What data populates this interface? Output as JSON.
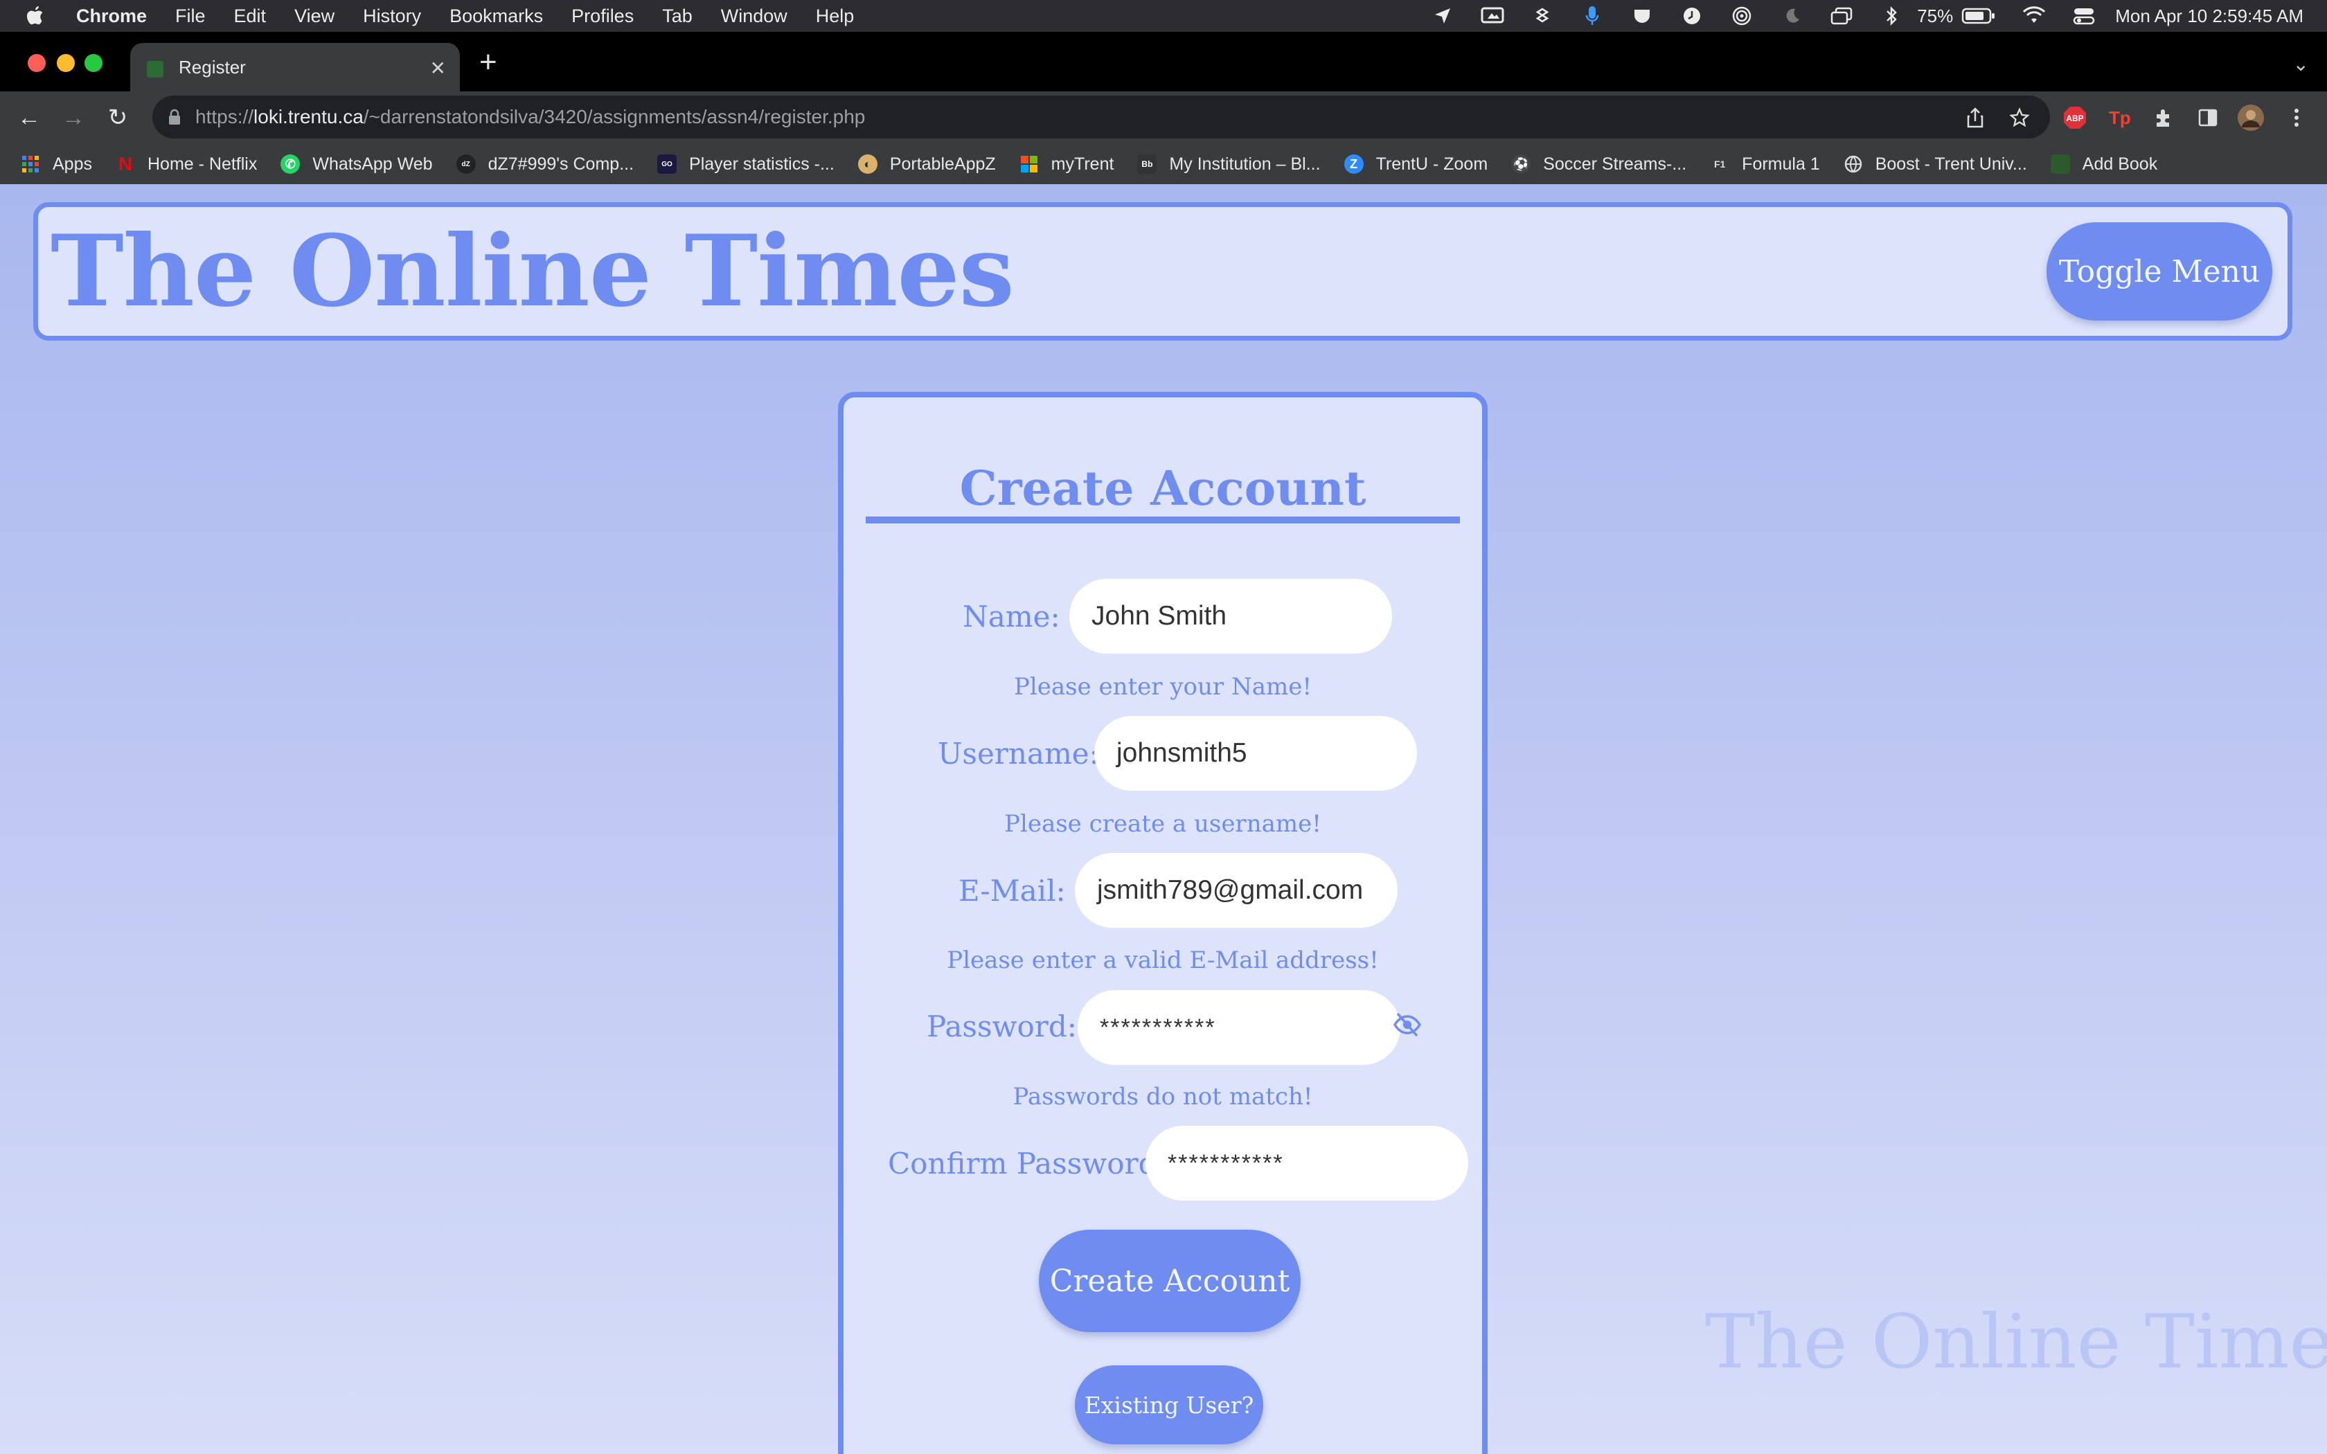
{
  "menubar": {
    "app": "Chrome",
    "items": [
      "File",
      "Edit",
      "View",
      "History",
      "Bookmarks",
      "Profiles",
      "Tab",
      "Window",
      "Help"
    ],
    "battery": "75%",
    "datetime": "Mon Apr 10  2:59:45 AM"
  },
  "browser": {
    "tab_title": "Register",
    "url_prefix": "https://",
    "url_host": "loki.trentu.ca",
    "url_path": "/~darrenstatondsilva/3420/assignments/assn4/register.php",
    "bookmarks": [
      {
        "label": "Apps",
        "icon": "apps-grid-icon"
      },
      {
        "label": "Home - Netflix",
        "icon": "netflix-icon"
      },
      {
        "label": "WhatsApp Web",
        "icon": "whatsapp-icon"
      },
      {
        "label": "dZ7#999's Comp...",
        "icon": "site-icon"
      },
      {
        "label": "Player statistics -...",
        "icon": "site-icon"
      },
      {
        "label": "PortableAppZ",
        "icon": "portableappz-icon"
      },
      {
        "label": "myTrent",
        "icon": "microsoft-icon"
      },
      {
        "label": "My Institution – Bl...",
        "icon": "blackboard-icon"
      },
      {
        "label": "TrentU - Zoom",
        "icon": "zoom-icon"
      },
      {
        "label": "Soccer Streams-...",
        "icon": "soccer-icon"
      },
      {
        "label": "Formula 1",
        "icon": "f1-icon"
      },
      {
        "label": "Boost - Trent Univ...",
        "icon": "globe-icon"
      },
      {
        "label": "Add Book",
        "icon": "leaf-icon"
      }
    ]
  },
  "header": {
    "site_title": "The Online Times",
    "toggle_label": "Toggle Menu"
  },
  "form": {
    "title": "Create Account",
    "name_label": "Name:",
    "name_value": "John Smith",
    "name_hint": "Please enter your Name!",
    "username_label": "Username:",
    "username_value": "johnsmith5",
    "username_hint": "Please create a username!",
    "email_label": "E-Mail:",
    "email_value": "jsmith789@gmail.com",
    "email_hint": "Please enter a valid E-Mail address!",
    "password_label": "Password:",
    "password_value": "***********",
    "password_hint": "Passwords do not match!",
    "confirm_label": "Confirm Password:",
    "confirm_value": "***********",
    "submit_label": "Create Account",
    "existing_label": "Existing User?"
  },
  "footer": {
    "watermark": "The Online Times"
  },
  "colors": {
    "accent": "#6f8cf0",
    "panel": "#dde3fb"
  }
}
